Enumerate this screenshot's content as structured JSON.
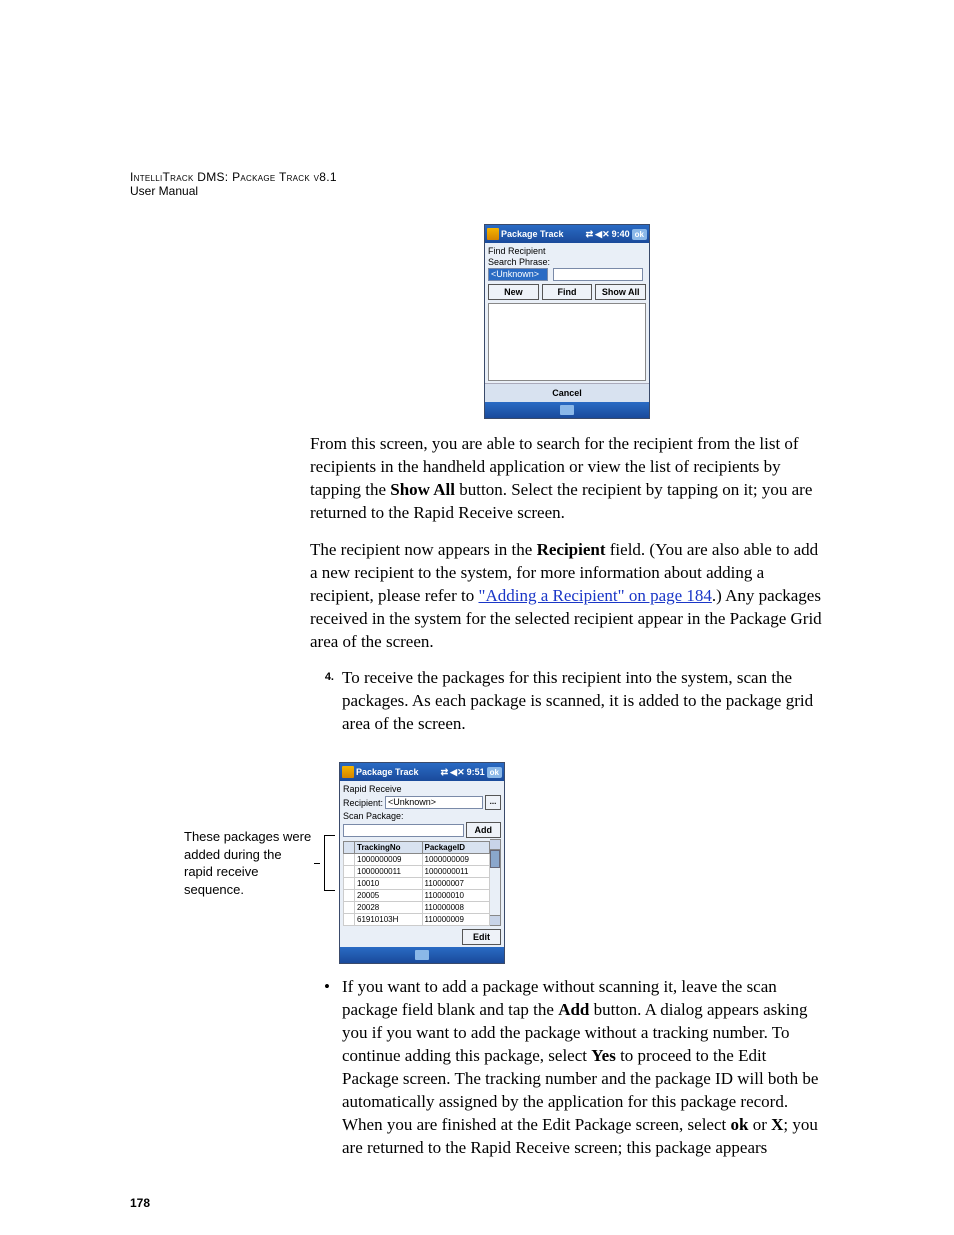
{
  "header": {
    "product": "IntelliTrack DMS: Package Track v8.1",
    "sub": "User Manual"
  },
  "page_number": "178",
  "device1": {
    "title": "Package Track",
    "time": "9:40",
    "ok": "ok",
    "heading": "Find Recipient",
    "search_label": "Search Phrase:",
    "search_value": "<Unknown>",
    "btn_new": "New",
    "btn_find": "Find",
    "btn_showall": "Show All",
    "cancel": "Cancel"
  },
  "para1": {
    "a": "From this screen, you are able to search for the recipient from the list of recipients in the handheld application or view the list of recipients by tapping the ",
    "b": "Show All",
    "c": " button. Select the recipient by tapping on it; you are returned to the Rapid Receive screen."
  },
  "para2": {
    "a": "The recipient now appears in the ",
    "b": "Recipient",
    "c": " field. (You are also able to add a new recipient to the system, for more information about adding a recipient, please refer to ",
    "link": "\"Adding a Recipient\" on page 184",
    "d": ".) Any packages received in the system for the selected recipient appear in the Package Grid area of the screen."
  },
  "step4": {
    "num": "4.",
    "text": "To receive the packages for this recipient into the system, scan the packages. As each package is scanned, it is added to the package grid area of the screen."
  },
  "callout": "These packages were added during the rapid receive sequence.",
  "device2": {
    "title": "Package Track",
    "time": "9:51",
    "ok": "ok",
    "heading": "Rapid Receive",
    "recipient_label": "Recipient:",
    "recipient_value": "<Unknown>",
    "ellipsis": "...",
    "scan_label": "Scan Package:",
    "add": "Add",
    "col1": "TrackingNo",
    "col2": "PackageID",
    "rows": [
      {
        "t": "1000000009",
        "p": "1000000009"
      },
      {
        "t": "1000000011",
        "p": "1000000011"
      },
      {
        "t": "10010",
        "p": "110000007"
      },
      {
        "t": "20005",
        "p": "110000010"
      },
      {
        "t": "20028",
        "p": "110000008"
      },
      {
        "t": "61910103H",
        "p": "110000009"
      }
    ],
    "edit": "Edit"
  },
  "bullet": {
    "a": "If you want to add a package without scanning it, leave the scan package field blank and tap the ",
    "b": "Add",
    "c": " button. A dialog appears asking you if you want to add the package without a tracking number. To continue adding this package, select ",
    "d": "Yes",
    "e": " to proceed to the Edit Package screen. The tracking number and the package ID will both be automatically assigned by the application for this package record. When you are finished at the Edit Package screen, select ",
    "f": "ok",
    "g": " or ",
    "h": "X",
    "i": "; you are returned to the Rapid Receive screen; this package appears"
  }
}
